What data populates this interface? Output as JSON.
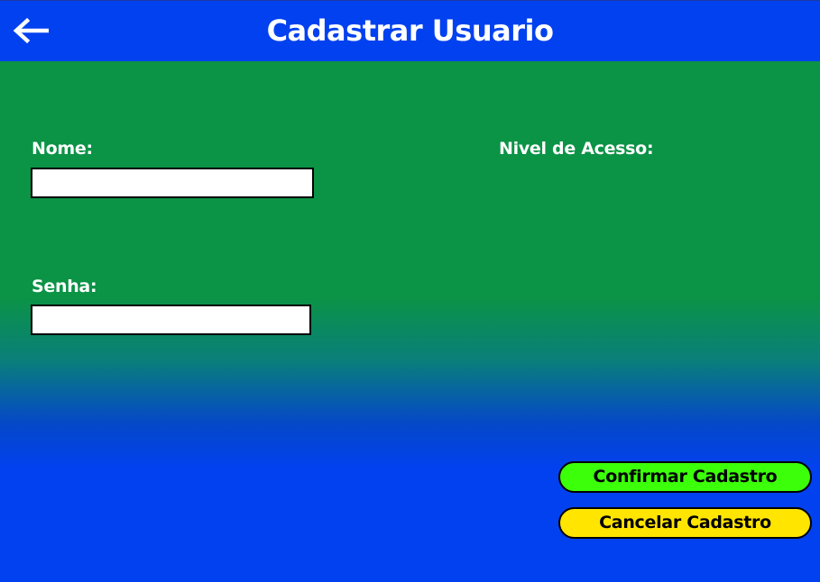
{
  "header": {
    "title": "Cadastrar Usuario",
    "back_icon": "arrow-left-icon",
    "background": "#0241ef"
  },
  "form": {
    "nome_label": "Nome:",
    "nome_value": "",
    "senha_label": "Senha:",
    "senha_value": "",
    "nivel_label": "Nivel de Acesso:"
  },
  "actions": {
    "confirm_label": "Confirmar Cadastro",
    "confirm_color": "#3cff0a",
    "cancel_label": "Cancelar Cadastro",
    "cancel_color": "#ffe500"
  },
  "colors": {
    "background_top": "#0b9346",
    "background_bottom": "#0241ef"
  }
}
